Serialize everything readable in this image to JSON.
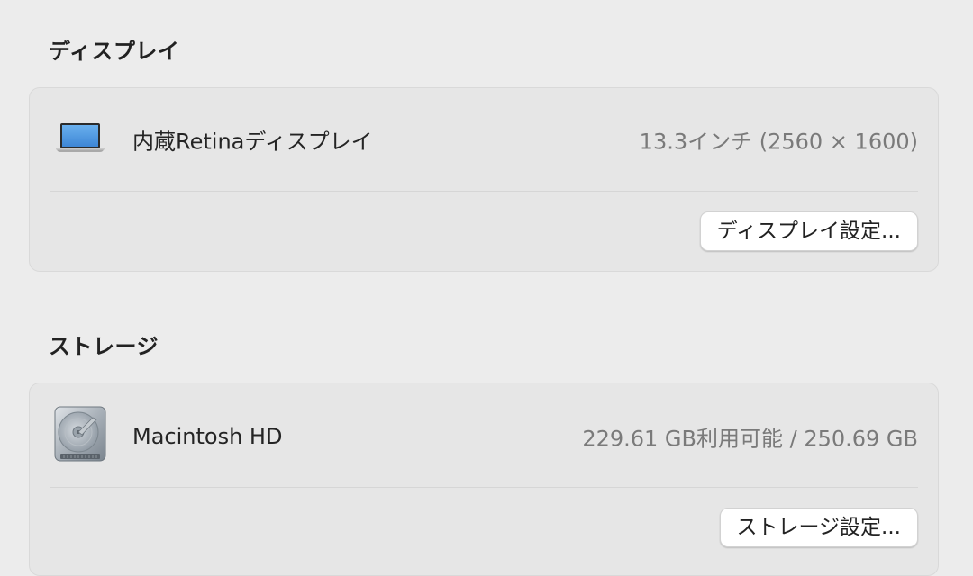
{
  "display_section": {
    "title": "ディスプレイ",
    "item": {
      "icon": "laptop-icon",
      "label": "内蔵Retinaディスプレイ",
      "value": "13.3インチ (2560 × 1600)"
    },
    "button_label": "ディスプレイ設定..."
  },
  "storage_section": {
    "title": "ストレージ",
    "item": {
      "icon": "hard-drive-icon",
      "label": "Macintosh HD",
      "value": "229.61 GB利用可能 / 250.69 GB"
    },
    "button_label": "ストレージ設定..."
  }
}
